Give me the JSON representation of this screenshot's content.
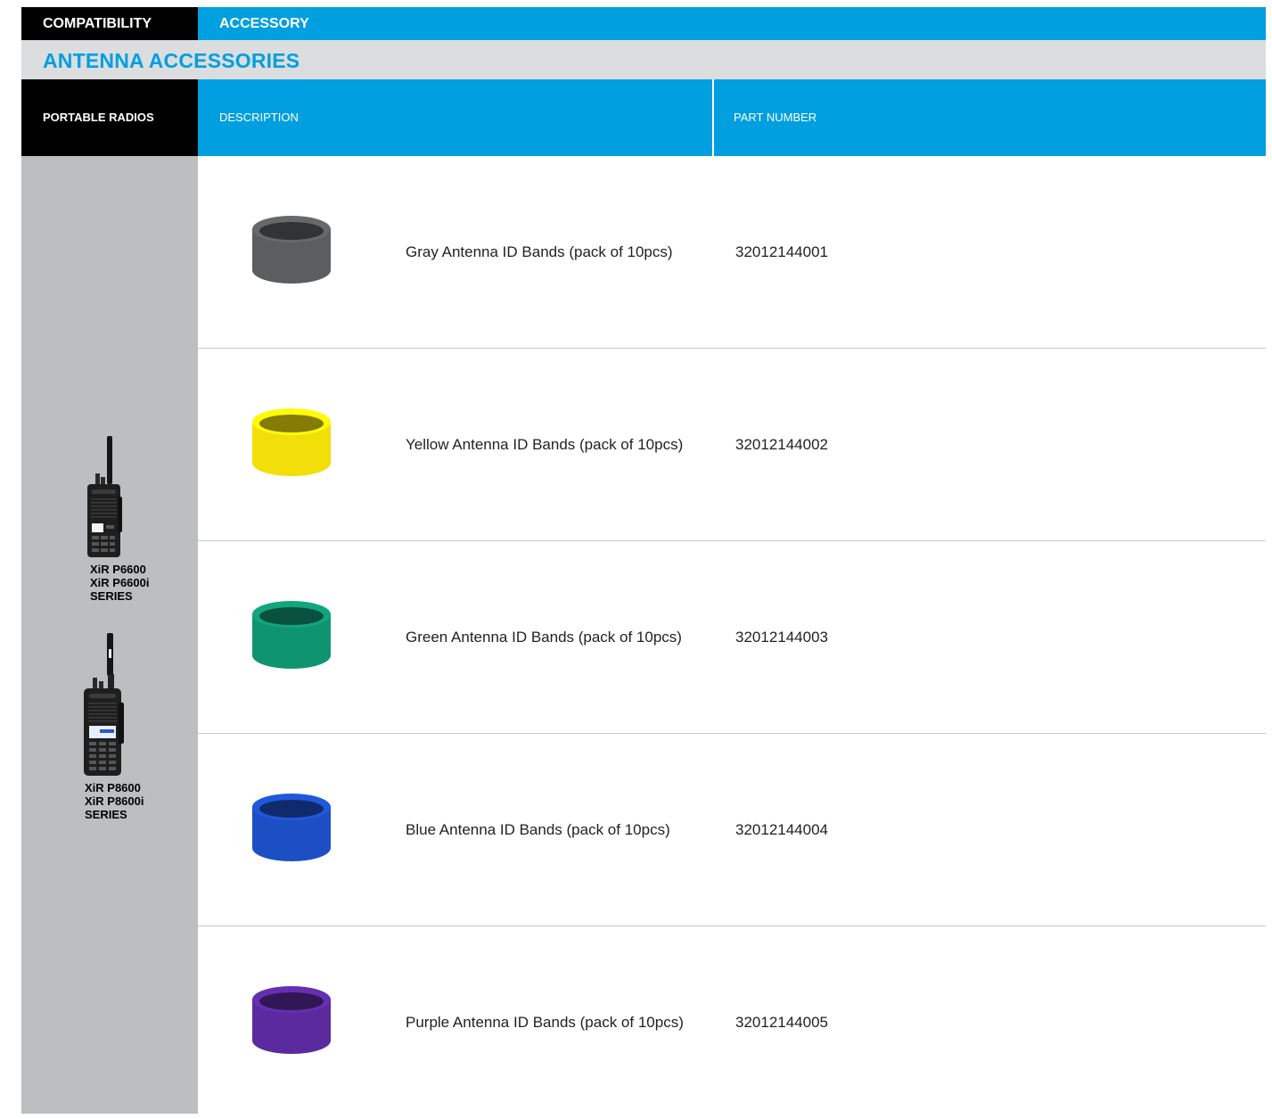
{
  "header": {
    "compatibility": "COMPATIBILITY",
    "accessory": "ACCESSORY"
  },
  "section_title": "ANTENNA ACCESSORIES",
  "columns": {
    "portable_radios": "PORTABLE RADIOS",
    "description": "DESCRIPTION",
    "part_number": "PART NUMBER"
  },
  "radios": [
    {
      "line1": "XiR P6600",
      "line2": "XiR P6600i",
      "line3": "SERIES"
    },
    {
      "line1": "XiR P8600",
      "line2": "XiR P8600i",
      "line3": "SERIES"
    }
  ],
  "products": [
    {
      "description": "Gray Antenna ID Bands (pack of 10pcs)",
      "part_number": "32012144001",
      "color": "#5b5d5f"
    },
    {
      "description": "Yellow Antenna ID Bands (pack of 10pcs)",
      "part_number": "32012144002",
      "color": "#f2df0a"
    },
    {
      "description": "Green Antenna ID Bands (pack of 10pcs)",
      "part_number": "32012144003",
      "color": "#0f9470"
    },
    {
      "description": "Blue Antenna ID Bands (pack of 10pcs)",
      "part_number": "32012144004",
      "color": "#1d4fc4"
    },
    {
      "description": "Purple Antenna ID Bands (pack of 10pcs)",
      "part_number": "32012144005",
      "color": "#5b2a9e"
    }
  ]
}
